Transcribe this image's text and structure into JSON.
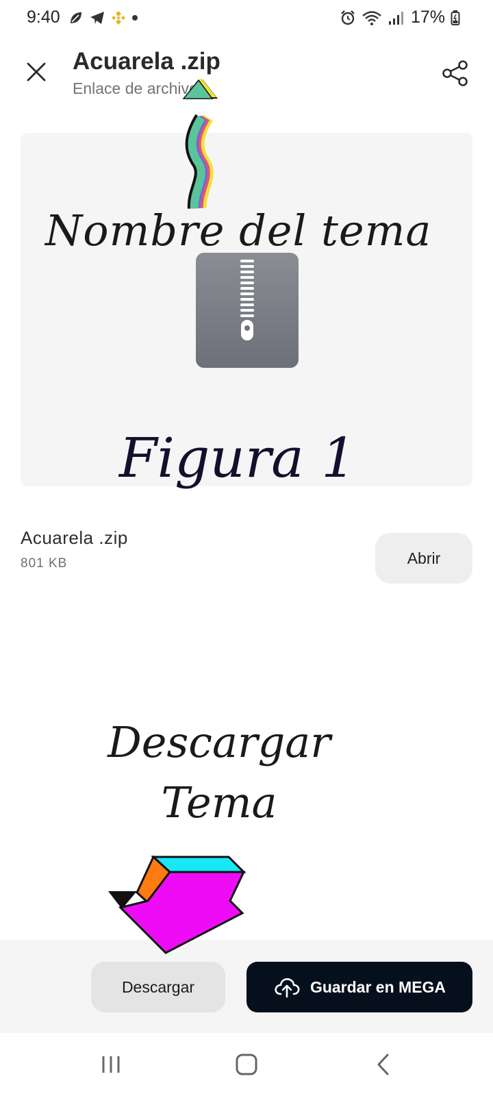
{
  "status_bar": {
    "time": "9:40",
    "battery_percent": "17%",
    "left_icons": [
      "leaf-icon",
      "telegram-icon",
      "binance-icon",
      "dot-icon"
    ],
    "right_icons": [
      "alarm-icon",
      "wifi-icon",
      "signal-icon",
      "battery-icon"
    ]
  },
  "header": {
    "title": "Acuarela .zip",
    "subtitle": "Enlace de archivo"
  },
  "annotations": {
    "theme_name": "Nombre del tema",
    "figure": "Figura 1",
    "download_line1": "Descargar",
    "download_line2": "Tema"
  },
  "file": {
    "name": "Acuarela .zip",
    "size": "801 KB",
    "open_label": "Abrir",
    "icon": "zip-archive-icon"
  },
  "actions": {
    "download_label": "Descargar",
    "save_label": "Guardar en MEGA"
  },
  "navigation": {
    "items": [
      "recent-apps-icon",
      "home-icon",
      "back-icon"
    ]
  },
  "colors": {
    "primary_button": "#06101d",
    "secondary_button": "#e4e4e4",
    "preview_background": "#f5f5f5"
  }
}
